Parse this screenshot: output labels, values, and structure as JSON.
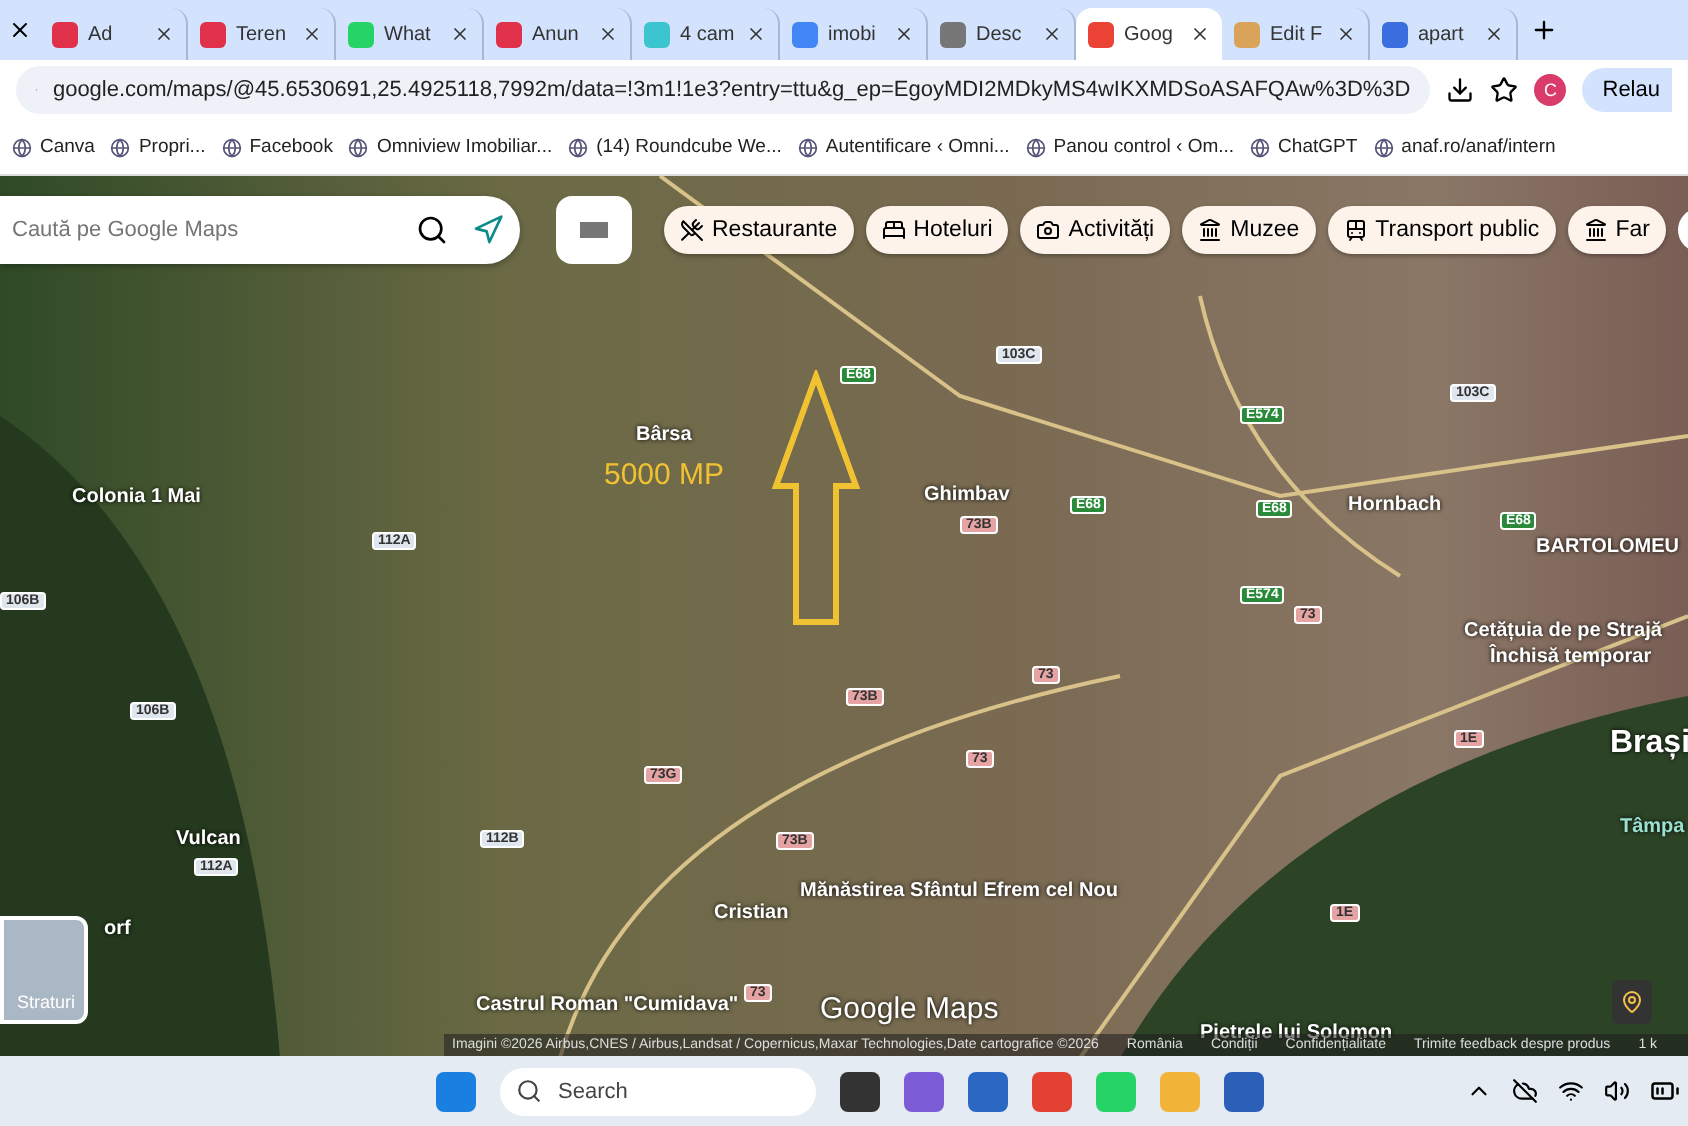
{
  "browser": {
    "tabs": [
      {
        "title": "Ad",
        "selected": false
      },
      {
        "title": "Teren",
        "selected": false
      },
      {
        "title": "What",
        "selected": false
      },
      {
        "title": "Anun",
        "selected": false
      },
      {
        "title": "4 cam",
        "selected": false
      },
      {
        "title": "imobi",
        "selected": false
      },
      {
        "title": "Desc",
        "selected": false
      },
      {
        "title": "Goog",
        "selected": true
      },
      {
        "title": "Edit F",
        "selected": false
      },
      {
        "title": "apart",
        "selected": false
      }
    ],
    "url": "google.com/maps/@45.6530691,25.4925118,7992m/data=!3m1!1e3?entry=ttu&g_ep=EgoyMDI2MDkyMS4wIKXMDSoASAFQAw%3D%3D",
    "profile": "C",
    "relaunch": "Relau",
    "bookmarks": [
      "Canva",
      "Propri...",
      "Facebook",
      "Omniview Imobiliar...",
      "(14) Roundcube We...",
      "Autentificare ‹ Omni...",
      "Panou control ‹ Om...",
      "ChatGPT",
      "anaf.ro/anaf/intern"
    ]
  },
  "maps": {
    "search_placeholder": "Caută pe Google Maps",
    "chips": [
      "Restaurante",
      "Hoteluri",
      "Activități",
      "Muzee",
      "Transport public",
      "Far"
    ],
    "places": [
      "Colonia 1 Mai",
      "Ghimbav",
      "Hornbach",
      "BARTOLOMEU",
      "Cetățuia de pe Strajă",
      "Închisă temporar",
      "Brași",
      "Vulcan",
      "Cristian",
      "Mănăstirea Sfântul Efrem cel Nou",
      "Castrul Roman \"Cumidava\"",
      "Pietrele lui Solomon",
      "Tâmpa",
      "orf",
      "Bârsa"
    ],
    "roads": [
      "E68",
      "103C",
      "E574",
      "103C",
      "E68",
      "E68",
      "E68",
      "73B",
      "E574",
      "73",
      "73B",
      "73",
      "73G",
      "73B",
      "73",
      "1E",
      "1E",
      "112A",
      "106B",
      "106B",
      "112A",
      "112B",
      "73"
    ],
    "annotation": "5000 MP",
    "layers": "Straturi",
    "logo": "Google Maps",
    "footer": [
      "Imagini ©2026 Airbus,CNES / Airbus,Landsat / Copernicus,Maxar Technologies,Date cartografice ©2026",
      "România",
      "Condiții",
      "Confidențialitate",
      "Trimite feedback despre produs",
      "1 k"
    ]
  },
  "taskbar": {
    "search": "Search"
  }
}
